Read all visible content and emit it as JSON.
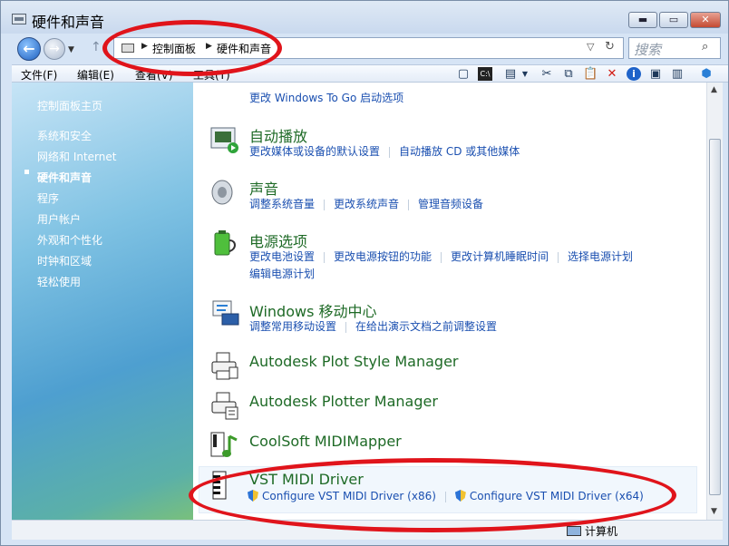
{
  "window": {
    "title": "硬件和声音",
    "minimize_glyph": "▬",
    "maximize_glyph": "▭",
    "close_glyph": "✕"
  },
  "address": {
    "breadcrumbs": [
      "控制面板",
      "硬件和声音"
    ],
    "search_placeholder": "搜索"
  },
  "menu": {
    "items": [
      "文件(F)",
      "编辑(E)",
      "查看(V)",
      "工具(T)"
    ]
  },
  "toolbar_icons": [
    "view-icon",
    "cmd-icon",
    "properties-icon",
    "cut-icon",
    "copy-icon",
    "paste-icon",
    "delete-icon",
    "info-icon",
    "web-icon",
    "ie-icon"
  ],
  "sidebar": {
    "home": "控制面板主页",
    "items": [
      "系统和安全",
      "网络和 Internet",
      "硬件和声音",
      "程序",
      "用户帐户",
      "外观和个性化",
      "时钟和区域",
      "轻松使用"
    ],
    "current_index": 2
  },
  "content": {
    "partial_link": "更改 Windows To Go 启动选项",
    "categories": [
      {
        "title": "自动播放",
        "links": [
          "更改媒体或设备的默认设置",
          "自动播放 CD 或其他媒体"
        ]
      },
      {
        "title": "声音",
        "links": [
          "调整系统音量",
          "更改系统声音",
          "管理音频设备"
        ]
      },
      {
        "title": "电源选项",
        "links": [
          "更改电池设置",
          "更改电源按钮的功能",
          "更改计算机睡眠时间",
          "选择电源计划"
        ],
        "links2": [
          "编辑电源计划"
        ]
      },
      {
        "title": "Windows 移动中心",
        "links": [
          "调整常用移动设置",
          "在给出演示文档之前调整设置"
        ]
      },
      {
        "title": "Autodesk Plot Style Manager",
        "links": []
      },
      {
        "title": "Autodesk Plotter Manager",
        "links": []
      },
      {
        "title": "CoolSoft MIDIMapper",
        "links": []
      },
      {
        "title": "VST MIDI Driver",
        "links": [
          "Configure VST MIDI Driver (x86)",
          "Configure VST MIDI Driver (x64)"
        ]
      }
    ]
  },
  "status": {
    "computer": "计算机"
  },
  "colors": {
    "annotation": "#e0141b",
    "category_title": "#1e6a26",
    "link": "#1a4fb0"
  }
}
